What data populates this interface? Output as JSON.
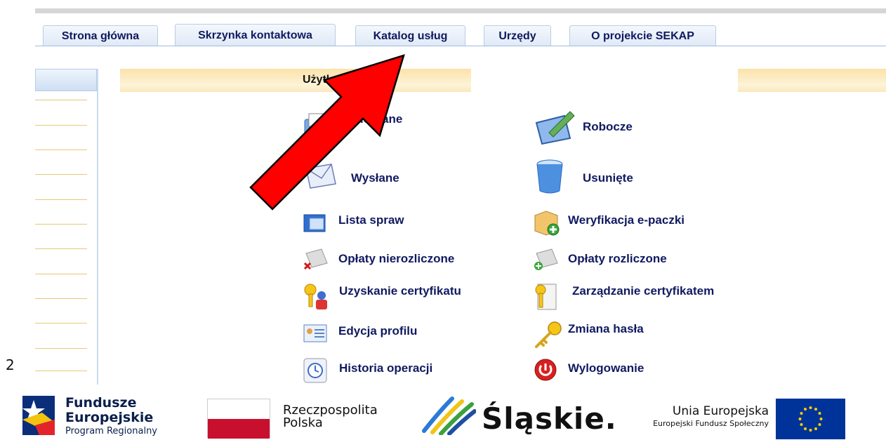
{
  "tabs": [
    {
      "label": "Strona główna"
    },
    {
      "label": "Skrzynka kontaktowa"
    },
    {
      "label": "Katalog usług"
    },
    {
      "label": "Urzędy"
    },
    {
      "label": "O projekcie SEKAP"
    }
  ],
  "banner": {
    "title": "Użytko"
  },
  "menu": {
    "odebrane": "Odebrane",
    "robocze": "Robocze",
    "wyslane": "Wysłane",
    "usuniete": "Usunięte",
    "lista_spraw": "Lista spraw",
    "weryfikacja": "Weryfikacja e-paczki",
    "oplaty_nierozliczone": "Opłaty nierozliczone",
    "oplaty_rozliczone": "Opłaty rozliczone",
    "uzyskanie_certyfikatu": "Uzyskanie certyfikatu",
    "zarzadzanie_certyfikatem": "Zarządzanie certyfikatem",
    "edycja_profilu": "Edycja profilu",
    "zmiana_hasla": "Zmiana hasła",
    "historia_operacji": "Historia operacji",
    "wylogowanie": "Wylogowanie"
  },
  "page_number": "2",
  "footer": {
    "fe_line1": "Fundusze",
    "fe_line2": "Europejskie",
    "fe_line3": "Program Regionalny",
    "rp_line1": "Rzeczpospolita",
    "rp_line2": "Polska",
    "slaskie": "Śląskie.",
    "ue_line1": "Unia Europejska",
    "ue_line2": "Europejski Fundusz Społeczny"
  },
  "colors": {
    "tab_text": "#101a60",
    "annotation_arrow": "#ff0000",
    "banner": "#fbe2a9"
  }
}
